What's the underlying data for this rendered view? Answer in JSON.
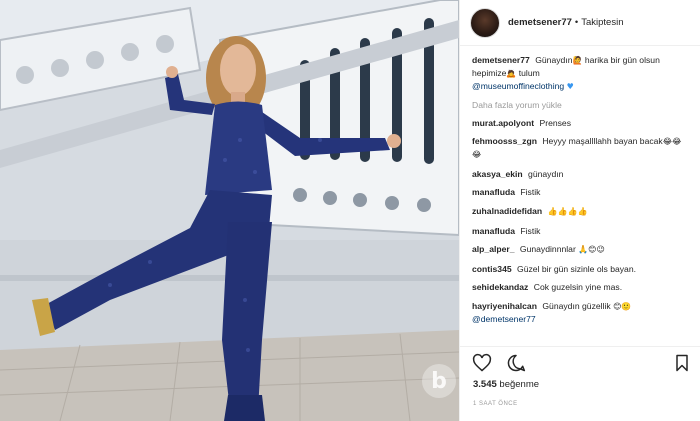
{
  "post": {
    "username": "demetsener77",
    "separator": "•",
    "follow_status": "Takiptesin",
    "caption": {
      "username": "demetsener77",
      "text": "Günaydın",
      "text2": "harika bir gün olsun hepimize",
      "text3": "tulum",
      "mention": "@museumoffineclothing"
    },
    "load_more": "Daha fazla yorum yükle",
    "comments": [
      {
        "user": "murat.apolyont",
        "text": "Prenses"
      },
      {
        "user": "fehmoosss_zgn",
        "text": "Heyyy maşallllahh bayan bacak",
        "emoji": "😂😂😂"
      },
      {
        "user": "akasya_ekin",
        "text": "günaydın"
      },
      {
        "user": "manafluda",
        "text": "Fistik"
      },
      {
        "user": "zuhalnadidefidan",
        "text": "",
        "emoji": "👍👍👍👍"
      },
      {
        "user": "manafluda",
        "text": "Fistik"
      },
      {
        "user": "alp_alper_",
        "text": "Gunaydinnnlar",
        "emoji": "🙏😊😉"
      },
      {
        "user": "contis345",
        "text": "Güzel bir gün sizinle ols bayan."
      },
      {
        "user": "sehidekandaz",
        "text": "Cok guzelsin yine mas."
      },
      {
        "user": "hayriyenihalcan",
        "text": "Günaydın güzellik",
        "emoji": "😊🙂",
        "mention": "@demetsener77"
      }
    ],
    "likes_count": "3.545",
    "likes_word": "beğenme",
    "time_ago": "1 SAAT ÖNCE",
    "watermark": "b"
  },
  "icons": {
    "like": "heart-icon",
    "comment": "comment-icon",
    "save": "bookmark-icon"
  },
  "colors": {
    "jumpsuit": "#1f2f73",
    "mention": "#003569",
    "muted": "#999999"
  }
}
